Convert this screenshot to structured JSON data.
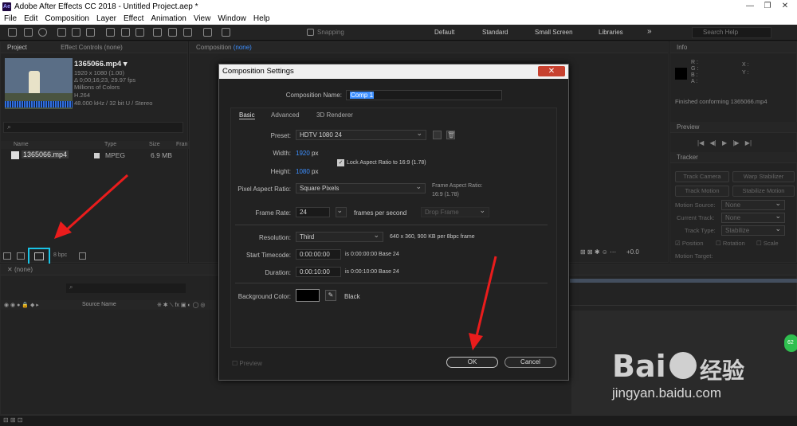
{
  "window": {
    "title": "Adobe After Effects CC 2018 - Untitled Project.aep *",
    "app_icon": "Ae",
    "controls": [
      "—",
      "❐",
      "✕"
    ]
  },
  "menu": [
    "File",
    "Edit",
    "Composition",
    "Layer",
    "Effect",
    "Animation",
    "View",
    "Window",
    "Help"
  ],
  "toolbar": {
    "snapping": "Snapping",
    "workspaces": [
      "Default",
      "Standard",
      "Small Screen",
      "Libraries"
    ],
    "more": "»",
    "search_placeholder": "Search Help"
  },
  "project": {
    "tabs": [
      "Project",
      "Effect Controls (none)"
    ],
    "clip": {
      "name": "1365066.mp4 ▾",
      "dims": "1920 x 1080 (1.00)",
      "duration": "Δ 0;00;16;23, 29.97 fps",
      "colors": "Millions of Colors",
      "codec": "H.264",
      "audio": "48.000 kHz / 32 bit U / Stereo"
    },
    "search_icon": "⌕",
    "columns": [
      "Name",
      "Type",
      "Size",
      "Fran"
    ],
    "row": {
      "name": "1365066.mp4",
      "type": "MPEG",
      "size": "6.9 MB"
    },
    "bpc": "8 bpc"
  },
  "comp_panel": {
    "tab_prefix": "Composition",
    "tab_value": "(none)"
  },
  "info_panel": {
    "title": "Info",
    "rgba": [
      "R :",
      "G :",
      "B :",
      "A :"
    ],
    "xy": [
      "X :",
      "Y :"
    ],
    "status": "Finished conforming 1365066.mp4"
  },
  "preview_panel": {
    "title": "Preview",
    "controls": [
      "|◀",
      "◀|",
      "▶",
      "|▶",
      "▶|"
    ]
  },
  "tracker_panel": {
    "title": "Tracker",
    "buttons": [
      "Track Camera",
      "Warp Stabilizer",
      "Track Motion",
      "Stabilize Motion"
    ],
    "rows": [
      {
        "label": "Motion Source:",
        "value": "None"
      },
      {
        "label": "Current Track:",
        "value": "None"
      },
      {
        "label": "Track Type:",
        "value": "Stabilize"
      }
    ],
    "checks": [
      "Position",
      "Rotation",
      "Scale"
    ],
    "motion_target": "Motion Target:"
  },
  "timeline": {
    "tab": "(none)",
    "source_name": "Source Name",
    "search_icon": "⌕"
  },
  "status_bar": {
    "zoom": "+0.0"
  },
  "dialog": {
    "title": "Composition Settings",
    "close": "✕",
    "comp_name_label": "Composition Name:",
    "comp_name_value": "Comp 1",
    "tabs": [
      "Basic",
      "Advanced",
      "3D Renderer"
    ],
    "preset_label": "Preset:",
    "preset_value": "HDTV 1080 24",
    "width_label": "Width:",
    "width_value": "1920",
    "width_unit": "px",
    "height_label": "Height:",
    "height_value": "1080",
    "height_unit": "px",
    "lock_aspect": "Lock Aspect Ratio to 16:9 (1.78)",
    "par_label": "Pixel Aspect Ratio:",
    "par_value": "Square Pixels",
    "frame_aspect": "Frame Aspect Ratio:",
    "frame_aspect_value": "16:9 (1.78)",
    "fps_label": "Frame Rate:",
    "fps_value": "24",
    "fps_unit": "frames per second",
    "drop_frame": "Drop Frame",
    "res_label": "Resolution:",
    "res_value": "Third",
    "res_info": "640 x 360, 900 KB per 8bpc frame",
    "start_label": "Start Timecode:",
    "start_value": "0:00:00:00",
    "start_info": "is 0:00:00:00  Base 24",
    "dur_label": "Duration:",
    "dur_value": "0:00:10:00",
    "dur_info": "is 0:00:10:00  Base 24",
    "bg_label": "Background Color:",
    "bg_name": "Black",
    "bg_color": "#000000",
    "preview": "Preview",
    "ok": "OK",
    "cancel": "Cancel"
  },
  "watermark": {
    "brand": "Bai",
    "brand2": "经验",
    "url": "jingyan.baidu.com",
    "badge": "62"
  },
  "colors": {
    "accent": "#3d8fff",
    "highlight_box": "#19c3e6",
    "arrow": "#ea1c1c",
    "dialog_close": "#c7412f"
  }
}
